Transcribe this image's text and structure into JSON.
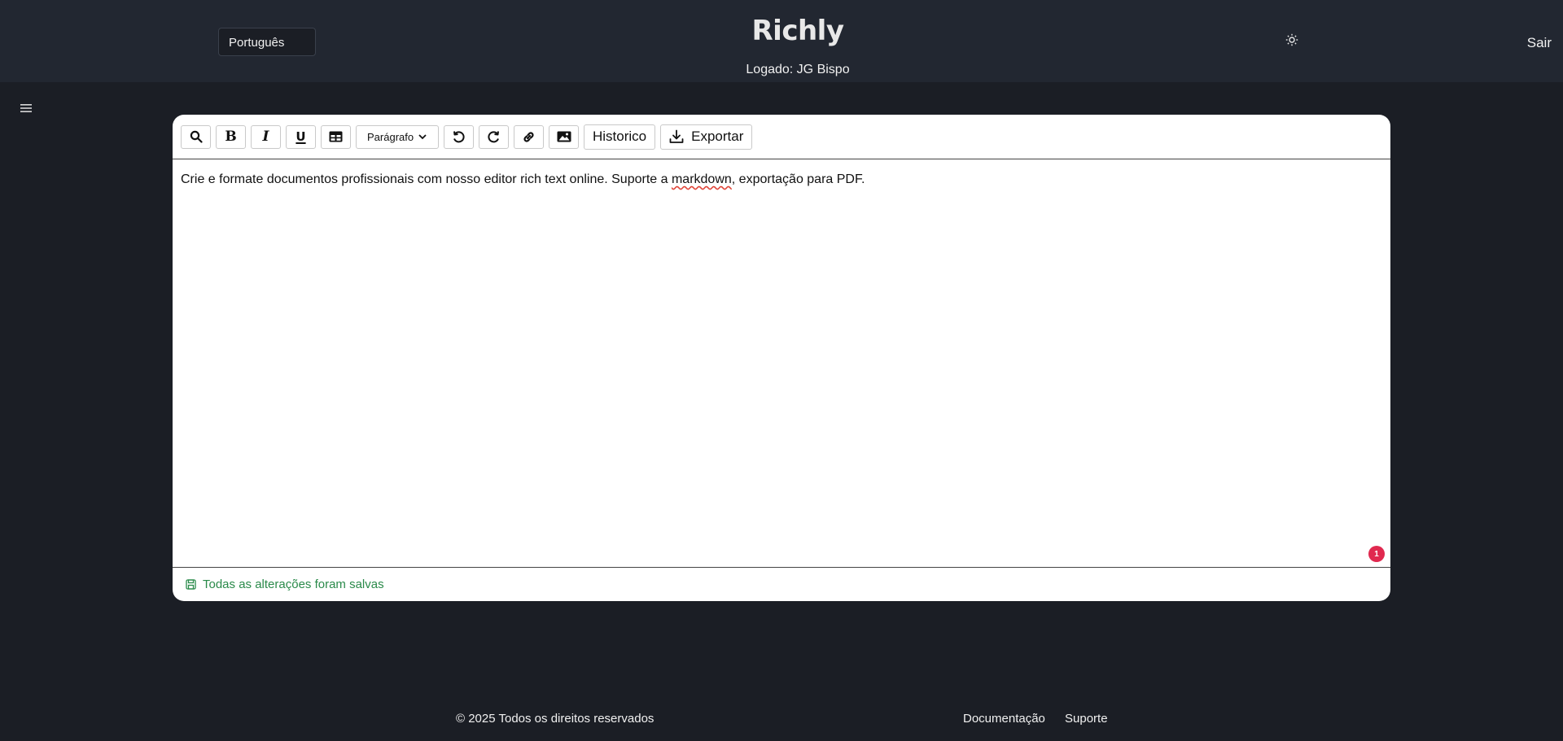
{
  "header": {
    "language_selected": "Português",
    "brand": "Richly",
    "logged_in": "Logado: JG Bispo",
    "logout_label": "Sair",
    "theme_icon": "sun-icon"
  },
  "toolbar": {
    "format_selected": "Parágrafo",
    "history_label": "Historico",
    "export_label": "Exportar",
    "icons": [
      "search-icon",
      "bold-icon",
      "italic-icon",
      "underline-icon",
      "table-icon",
      "undo-icon",
      "redo-icon",
      "link-icon",
      "image-icon",
      "download-icon"
    ]
  },
  "editor": {
    "content_before": "Crie e formate documentos profissionais com nosso editor rich text online. Suporte a ",
    "content_misspelled": "markdown",
    "content_after": ", exportação para PDF.",
    "issue_count": "1",
    "status_text": "Todas as alterações foram salvas"
  },
  "footer": {
    "copyright": "© 2025 Todos os direitos reservados",
    "docs_label": "Documentação",
    "support_label": "Suporte"
  },
  "colors": {
    "background": "#1b1e25",
    "header": "#222731",
    "saved_green": "#2a8a4a",
    "badge_red": "#e0294f"
  }
}
